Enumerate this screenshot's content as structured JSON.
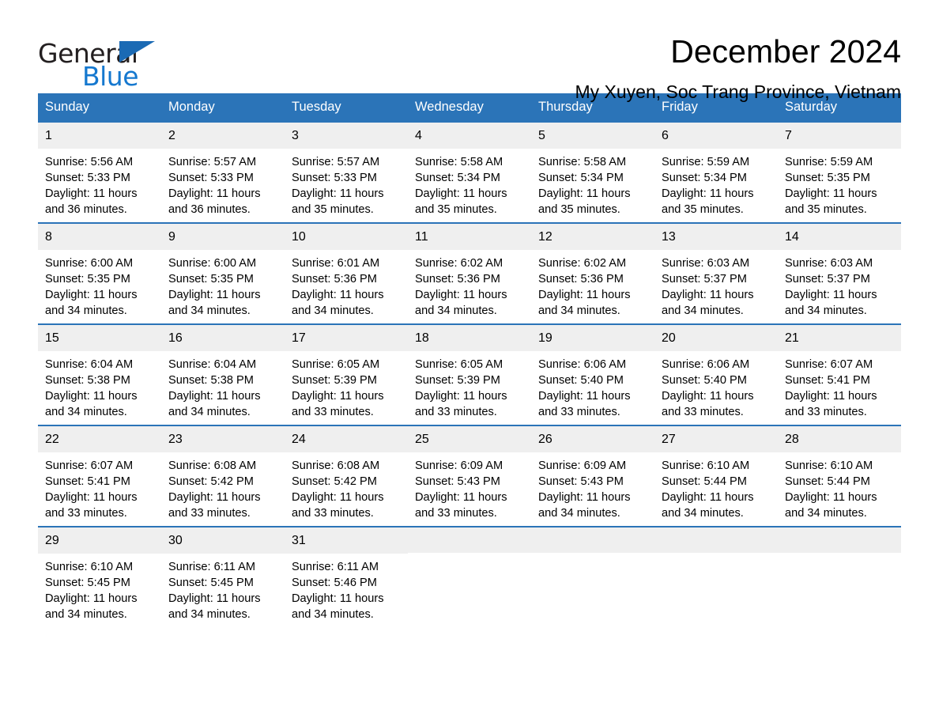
{
  "brand": {
    "name_part1": "General",
    "name_part2": "Blue",
    "triangle_icon": "triangle-icon",
    "accent_color": "#1b6ab4",
    "blue_text_color": "#1578cf"
  },
  "header": {
    "title": "December 2024",
    "location": "My Xuyen, Soc Trang Province, Vietnam"
  },
  "calendar": {
    "header_bg": "#2b74b8",
    "header_text_color": "#ffffff",
    "daynum_bg": "#efefef",
    "weekday_headers": [
      "Sunday",
      "Monday",
      "Tuesday",
      "Wednesday",
      "Thursday",
      "Friday",
      "Saturday"
    ],
    "weeks": [
      [
        {
          "day": "1",
          "sunrise": "Sunrise: 5:56 AM",
          "sunset": "Sunset: 5:33 PM",
          "daylight_line1": "Daylight: 11 hours",
          "daylight_line2": "and 36 minutes."
        },
        {
          "day": "2",
          "sunrise": "Sunrise: 5:57 AM",
          "sunset": "Sunset: 5:33 PM",
          "daylight_line1": "Daylight: 11 hours",
          "daylight_line2": "and 36 minutes."
        },
        {
          "day": "3",
          "sunrise": "Sunrise: 5:57 AM",
          "sunset": "Sunset: 5:33 PM",
          "daylight_line1": "Daylight: 11 hours",
          "daylight_line2": "and 35 minutes."
        },
        {
          "day": "4",
          "sunrise": "Sunrise: 5:58 AM",
          "sunset": "Sunset: 5:34 PM",
          "daylight_line1": "Daylight: 11 hours",
          "daylight_line2": "and 35 minutes."
        },
        {
          "day": "5",
          "sunrise": "Sunrise: 5:58 AM",
          "sunset": "Sunset: 5:34 PM",
          "daylight_line1": "Daylight: 11 hours",
          "daylight_line2": "and 35 minutes."
        },
        {
          "day": "6",
          "sunrise": "Sunrise: 5:59 AM",
          "sunset": "Sunset: 5:34 PM",
          "daylight_line1": "Daylight: 11 hours",
          "daylight_line2": "and 35 minutes."
        },
        {
          "day": "7",
          "sunrise": "Sunrise: 5:59 AM",
          "sunset": "Sunset: 5:35 PM",
          "daylight_line1": "Daylight: 11 hours",
          "daylight_line2": "and 35 minutes."
        }
      ],
      [
        {
          "day": "8",
          "sunrise": "Sunrise: 6:00 AM",
          "sunset": "Sunset: 5:35 PM",
          "daylight_line1": "Daylight: 11 hours",
          "daylight_line2": "and 34 minutes."
        },
        {
          "day": "9",
          "sunrise": "Sunrise: 6:00 AM",
          "sunset": "Sunset: 5:35 PM",
          "daylight_line1": "Daylight: 11 hours",
          "daylight_line2": "and 34 minutes."
        },
        {
          "day": "10",
          "sunrise": "Sunrise: 6:01 AM",
          "sunset": "Sunset: 5:36 PM",
          "daylight_line1": "Daylight: 11 hours",
          "daylight_line2": "and 34 minutes."
        },
        {
          "day": "11",
          "sunrise": "Sunrise: 6:02 AM",
          "sunset": "Sunset: 5:36 PM",
          "daylight_line1": "Daylight: 11 hours",
          "daylight_line2": "and 34 minutes."
        },
        {
          "day": "12",
          "sunrise": "Sunrise: 6:02 AM",
          "sunset": "Sunset: 5:36 PM",
          "daylight_line1": "Daylight: 11 hours",
          "daylight_line2": "and 34 minutes."
        },
        {
          "day": "13",
          "sunrise": "Sunrise: 6:03 AM",
          "sunset": "Sunset: 5:37 PM",
          "daylight_line1": "Daylight: 11 hours",
          "daylight_line2": "and 34 minutes."
        },
        {
          "day": "14",
          "sunrise": "Sunrise: 6:03 AM",
          "sunset": "Sunset: 5:37 PM",
          "daylight_line1": "Daylight: 11 hours",
          "daylight_line2": "and 34 minutes."
        }
      ],
      [
        {
          "day": "15",
          "sunrise": "Sunrise: 6:04 AM",
          "sunset": "Sunset: 5:38 PM",
          "daylight_line1": "Daylight: 11 hours",
          "daylight_line2": "and 34 minutes."
        },
        {
          "day": "16",
          "sunrise": "Sunrise: 6:04 AM",
          "sunset": "Sunset: 5:38 PM",
          "daylight_line1": "Daylight: 11 hours",
          "daylight_line2": "and 34 minutes."
        },
        {
          "day": "17",
          "sunrise": "Sunrise: 6:05 AM",
          "sunset": "Sunset: 5:39 PM",
          "daylight_line1": "Daylight: 11 hours",
          "daylight_line2": "and 33 minutes."
        },
        {
          "day": "18",
          "sunrise": "Sunrise: 6:05 AM",
          "sunset": "Sunset: 5:39 PM",
          "daylight_line1": "Daylight: 11 hours",
          "daylight_line2": "and 33 minutes."
        },
        {
          "day": "19",
          "sunrise": "Sunrise: 6:06 AM",
          "sunset": "Sunset: 5:40 PM",
          "daylight_line1": "Daylight: 11 hours",
          "daylight_line2": "and 33 minutes."
        },
        {
          "day": "20",
          "sunrise": "Sunrise: 6:06 AM",
          "sunset": "Sunset: 5:40 PM",
          "daylight_line1": "Daylight: 11 hours",
          "daylight_line2": "and 33 minutes."
        },
        {
          "day": "21",
          "sunrise": "Sunrise: 6:07 AM",
          "sunset": "Sunset: 5:41 PM",
          "daylight_line1": "Daylight: 11 hours",
          "daylight_line2": "and 33 minutes."
        }
      ],
      [
        {
          "day": "22",
          "sunrise": "Sunrise: 6:07 AM",
          "sunset": "Sunset: 5:41 PM",
          "daylight_line1": "Daylight: 11 hours",
          "daylight_line2": "and 33 minutes."
        },
        {
          "day": "23",
          "sunrise": "Sunrise: 6:08 AM",
          "sunset": "Sunset: 5:42 PM",
          "daylight_line1": "Daylight: 11 hours",
          "daylight_line2": "and 33 minutes."
        },
        {
          "day": "24",
          "sunrise": "Sunrise: 6:08 AM",
          "sunset": "Sunset: 5:42 PM",
          "daylight_line1": "Daylight: 11 hours",
          "daylight_line2": "and 33 minutes."
        },
        {
          "day": "25",
          "sunrise": "Sunrise: 6:09 AM",
          "sunset": "Sunset: 5:43 PM",
          "daylight_line1": "Daylight: 11 hours",
          "daylight_line2": "and 33 minutes."
        },
        {
          "day": "26",
          "sunrise": "Sunrise: 6:09 AM",
          "sunset": "Sunset: 5:43 PM",
          "daylight_line1": "Daylight: 11 hours",
          "daylight_line2": "and 34 minutes."
        },
        {
          "day": "27",
          "sunrise": "Sunrise: 6:10 AM",
          "sunset": "Sunset: 5:44 PM",
          "daylight_line1": "Daylight: 11 hours",
          "daylight_line2": "and 34 minutes."
        },
        {
          "day": "28",
          "sunrise": "Sunrise: 6:10 AM",
          "sunset": "Sunset: 5:44 PM",
          "daylight_line1": "Daylight: 11 hours",
          "daylight_line2": "and 34 minutes."
        }
      ],
      [
        {
          "day": "29",
          "sunrise": "Sunrise: 6:10 AM",
          "sunset": "Sunset: 5:45 PM",
          "daylight_line1": "Daylight: 11 hours",
          "daylight_line2": "and 34 minutes."
        },
        {
          "day": "30",
          "sunrise": "Sunrise: 6:11 AM",
          "sunset": "Sunset: 5:45 PM",
          "daylight_line1": "Daylight: 11 hours",
          "daylight_line2": "and 34 minutes."
        },
        {
          "day": "31",
          "sunrise": "Sunrise: 6:11 AM",
          "sunset": "Sunset: 5:46 PM",
          "daylight_line1": "Daylight: 11 hours",
          "daylight_line2": "and 34 minutes."
        },
        {
          "day": "",
          "sunrise": "",
          "sunset": "",
          "daylight_line1": "",
          "daylight_line2": ""
        },
        {
          "day": "",
          "sunrise": "",
          "sunset": "",
          "daylight_line1": "",
          "daylight_line2": ""
        },
        {
          "day": "",
          "sunrise": "",
          "sunset": "",
          "daylight_line1": "",
          "daylight_line2": ""
        },
        {
          "day": "",
          "sunrise": "",
          "sunset": "",
          "daylight_line1": "",
          "daylight_line2": ""
        }
      ]
    ]
  }
}
